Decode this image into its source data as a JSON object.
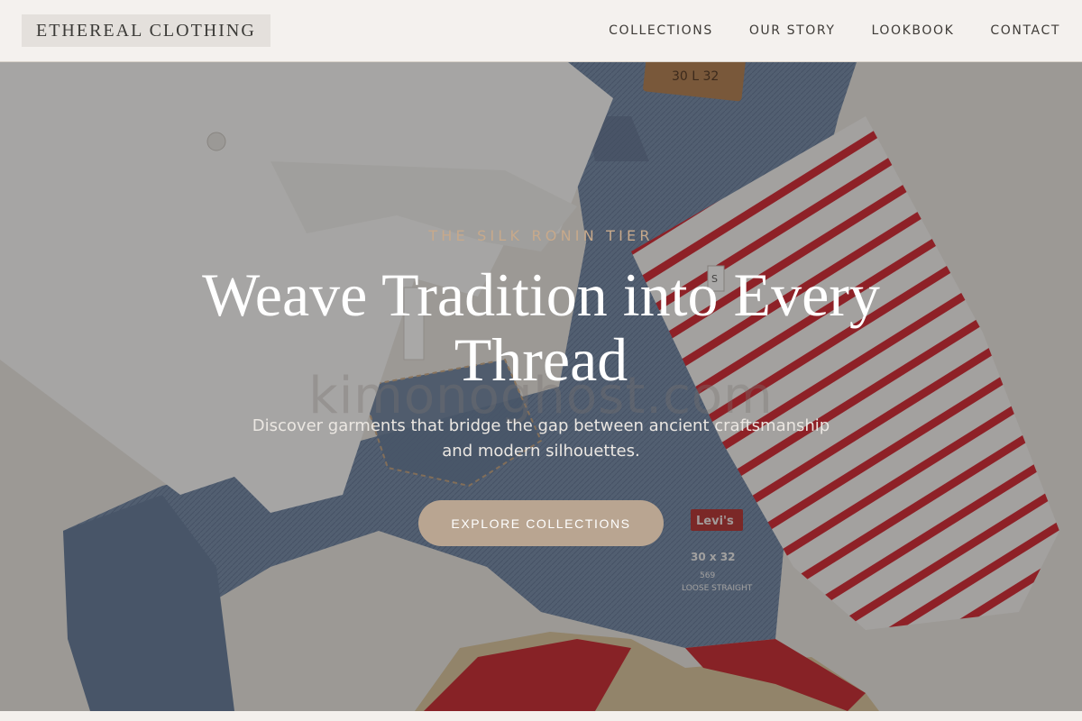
{
  "brand": {
    "name": "ETHEREAL CLOTHING"
  },
  "nav": {
    "items": [
      {
        "label": "COLLECTIONS"
      },
      {
        "label": "OUR STORY"
      },
      {
        "label": "LOOKBOOK"
      },
      {
        "label": "CONTACT"
      }
    ]
  },
  "hero": {
    "eyebrow": "THE SILK RONIN TIER",
    "headline": "Weave Tradition into Every Thread",
    "subtitle": "Discover garments that bridge the gap between ancient craftsmanship and modern silhouettes.",
    "cta_label": "EXPLORE COLLECTIONS",
    "watermark": "kimonoghost.com",
    "image_labels": {
      "jeans_patch": "30 L 32",
      "levis_tab": "Levi's",
      "size_print": "30 x 32",
      "fit_number": "569",
      "fit_print": "LOOSE STRAIGHT",
      "tag": "S"
    }
  },
  "colors": {
    "header_bg": "#f4f1ee",
    "accent": "#c7a98b",
    "cta_bg": "#b9a591",
    "text_dark": "#3b3a37"
  }
}
